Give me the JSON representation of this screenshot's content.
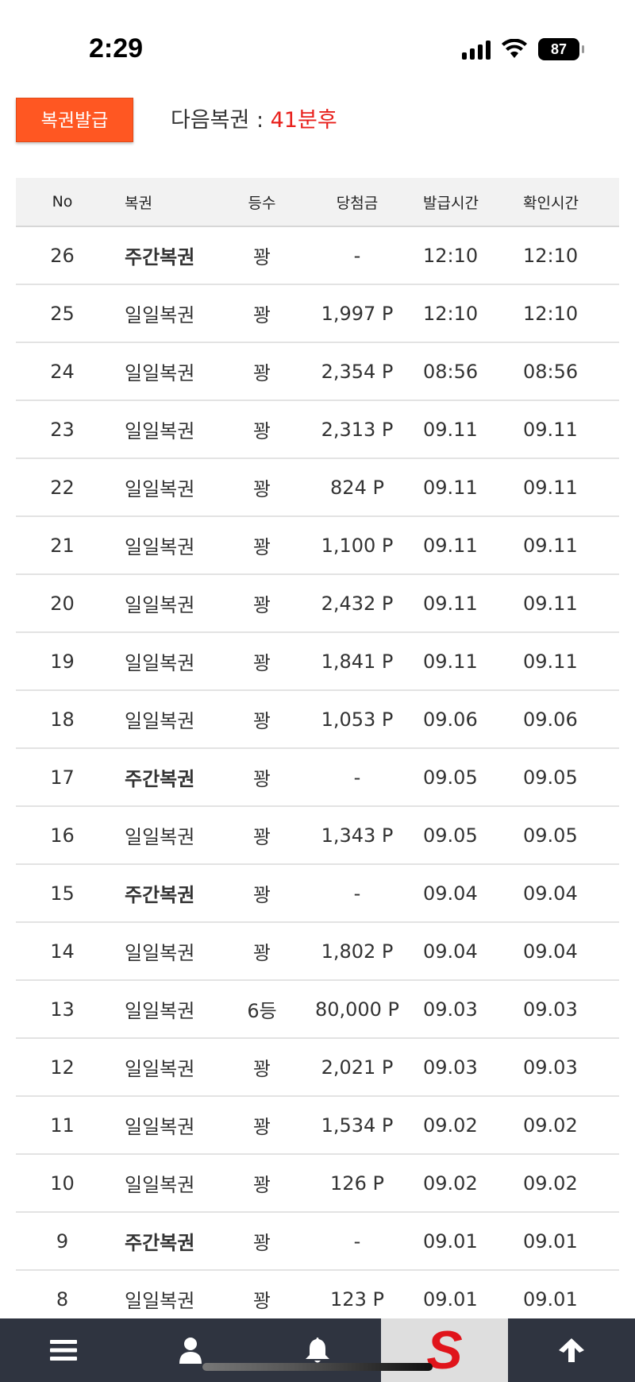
{
  "status_bar": {
    "time": "2:29",
    "battery": "87"
  },
  "issue_button": {
    "label": "복권발급"
  },
  "next_lottery": {
    "label": "다음복권 : ",
    "value": "41분후"
  },
  "table": {
    "headers": [
      "No",
      "복권",
      "등수",
      "당첨금",
      "발급시간",
      "확인시간"
    ],
    "rows": [
      {
        "no": "26",
        "type": "주간복권",
        "rank": "꽝",
        "prize": "-",
        "issued": "12:10",
        "checked": "12:10",
        "bold": true
      },
      {
        "no": "25",
        "type": "일일복권",
        "rank": "꽝",
        "prize": "1,997 P",
        "issued": "12:10",
        "checked": "12:10",
        "bold": false
      },
      {
        "no": "24",
        "type": "일일복권",
        "rank": "꽝",
        "prize": "2,354 P",
        "issued": "08:56",
        "checked": "08:56",
        "bold": false
      },
      {
        "no": "23",
        "type": "일일복권",
        "rank": "꽝",
        "prize": "2,313 P",
        "issued": "09.11",
        "checked": "09.11",
        "bold": false
      },
      {
        "no": "22",
        "type": "일일복권",
        "rank": "꽝",
        "prize": "824 P",
        "issued": "09.11",
        "checked": "09.11",
        "bold": false
      },
      {
        "no": "21",
        "type": "일일복권",
        "rank": "꽝",
        "prize": "1,100 P",
        "issued": "09.11",
        "checked": "09.11",
        "bold": false
      },
      {
        "no": "20",
        "type": "일일복권",
        "rank": "꽝",
        "prize": "2,432 P",
        "issued": "09.11",
        "checked": "09.11",
        "bold": false
      },
      {
        "no": "19",
        "type": "일일복권",
        "rank": "꽝",
        "prize": "1,841 P",
        "issued": "09.11",
        "checked": "09.11",
        "bold": false
      },
      {
        "no": "18",
        "type": "일일복권",
        "rank": "꽝",
        "prize": "1,053 P",
        "issued": "09.06",
        "checked": "09.06",
        "bold": false
      },
      {
        "no": "17",
        "type": "주간복권",
        "rank": "꽝",
        "prize": "-",
        "issued": "09.05",
        "checked": "09.05",
        "bold": true
      },
      {
        "no": "16",
        "type": "일일복권",
        "rank": "꽝",
        "prize": "1,343 P",
        "issued": "09.05",
        "checked": "09.05",
        "bold": false
      },
      {
        "no": "15",
        "type": "주간복권",
        "rank": "꽝",
        "prize": "-",
        "issued": "09.04",
        "checked": "09.04",
        "bold": true
      },
      {
        "no": "14",
        "type": "일일복권",
        "rank": "꽝",
        "prize": "1,802 P",
        "issued": "09.04",
        "checked": "09.04",
        "bold": false
      },
      {
        "no": "13",
        "type": "일일복권",
        "rank": "6등",
        "prize": "80,000 P",
        "issued": "09.03",
        "checked": "09.03",
        "bold": false
      },
      {
        "no": "12",
        "type": "일일복권",
        "rank": "꽝",
        "prize": "2,021 P",
        "issued": "09.03",
        "checked": "09.03",
        "bold": false
      },
      {
        "no": "11",
        "type": "일일복권",
        "rank": "꽝",
        "prize": "1,534 P",
        "issued": "09.02",
        "checked": "09.02",
        "bold": false
      },
      {
        "no": "10",
        "type": "일일복권",
        "rank": "꽝",
        "prize": "126 P",
        "issued": "09.02",
        "checked": "09.02",
        "bold": false
      },
      {
        "no": "9",
        "type": "주간복권",
        "rank": "꽝",
        "prize": "-",
        "issued": "09.01",
        "checked": "09.01",
        "bold": true
      },
      {
        "no": "8",
        "type": "일일복권",
        "rank": "꽝",
        "prize": "123 P",
        "issued": "09.01",
        "checked": "09.01",
        "bold": false
      }
    ]
  },
  "bottom_nav": {
    "items": [
      {
        "icon": "menu-icon"
      },
      {
        "icon": "user-icon"
      },
      {
        "icon": "bell-icon"
      },
      {
        "icon": "site-logo-icon",
        "letter": "S"
      },
      {
        "icon": "arrow-up-icon"
      }
    ]
  },
  "colors": {
    "accent": "#ff5722",
    "highlight": "#e8201c",
    "nav_bg": "#2f3440"
  }
}
